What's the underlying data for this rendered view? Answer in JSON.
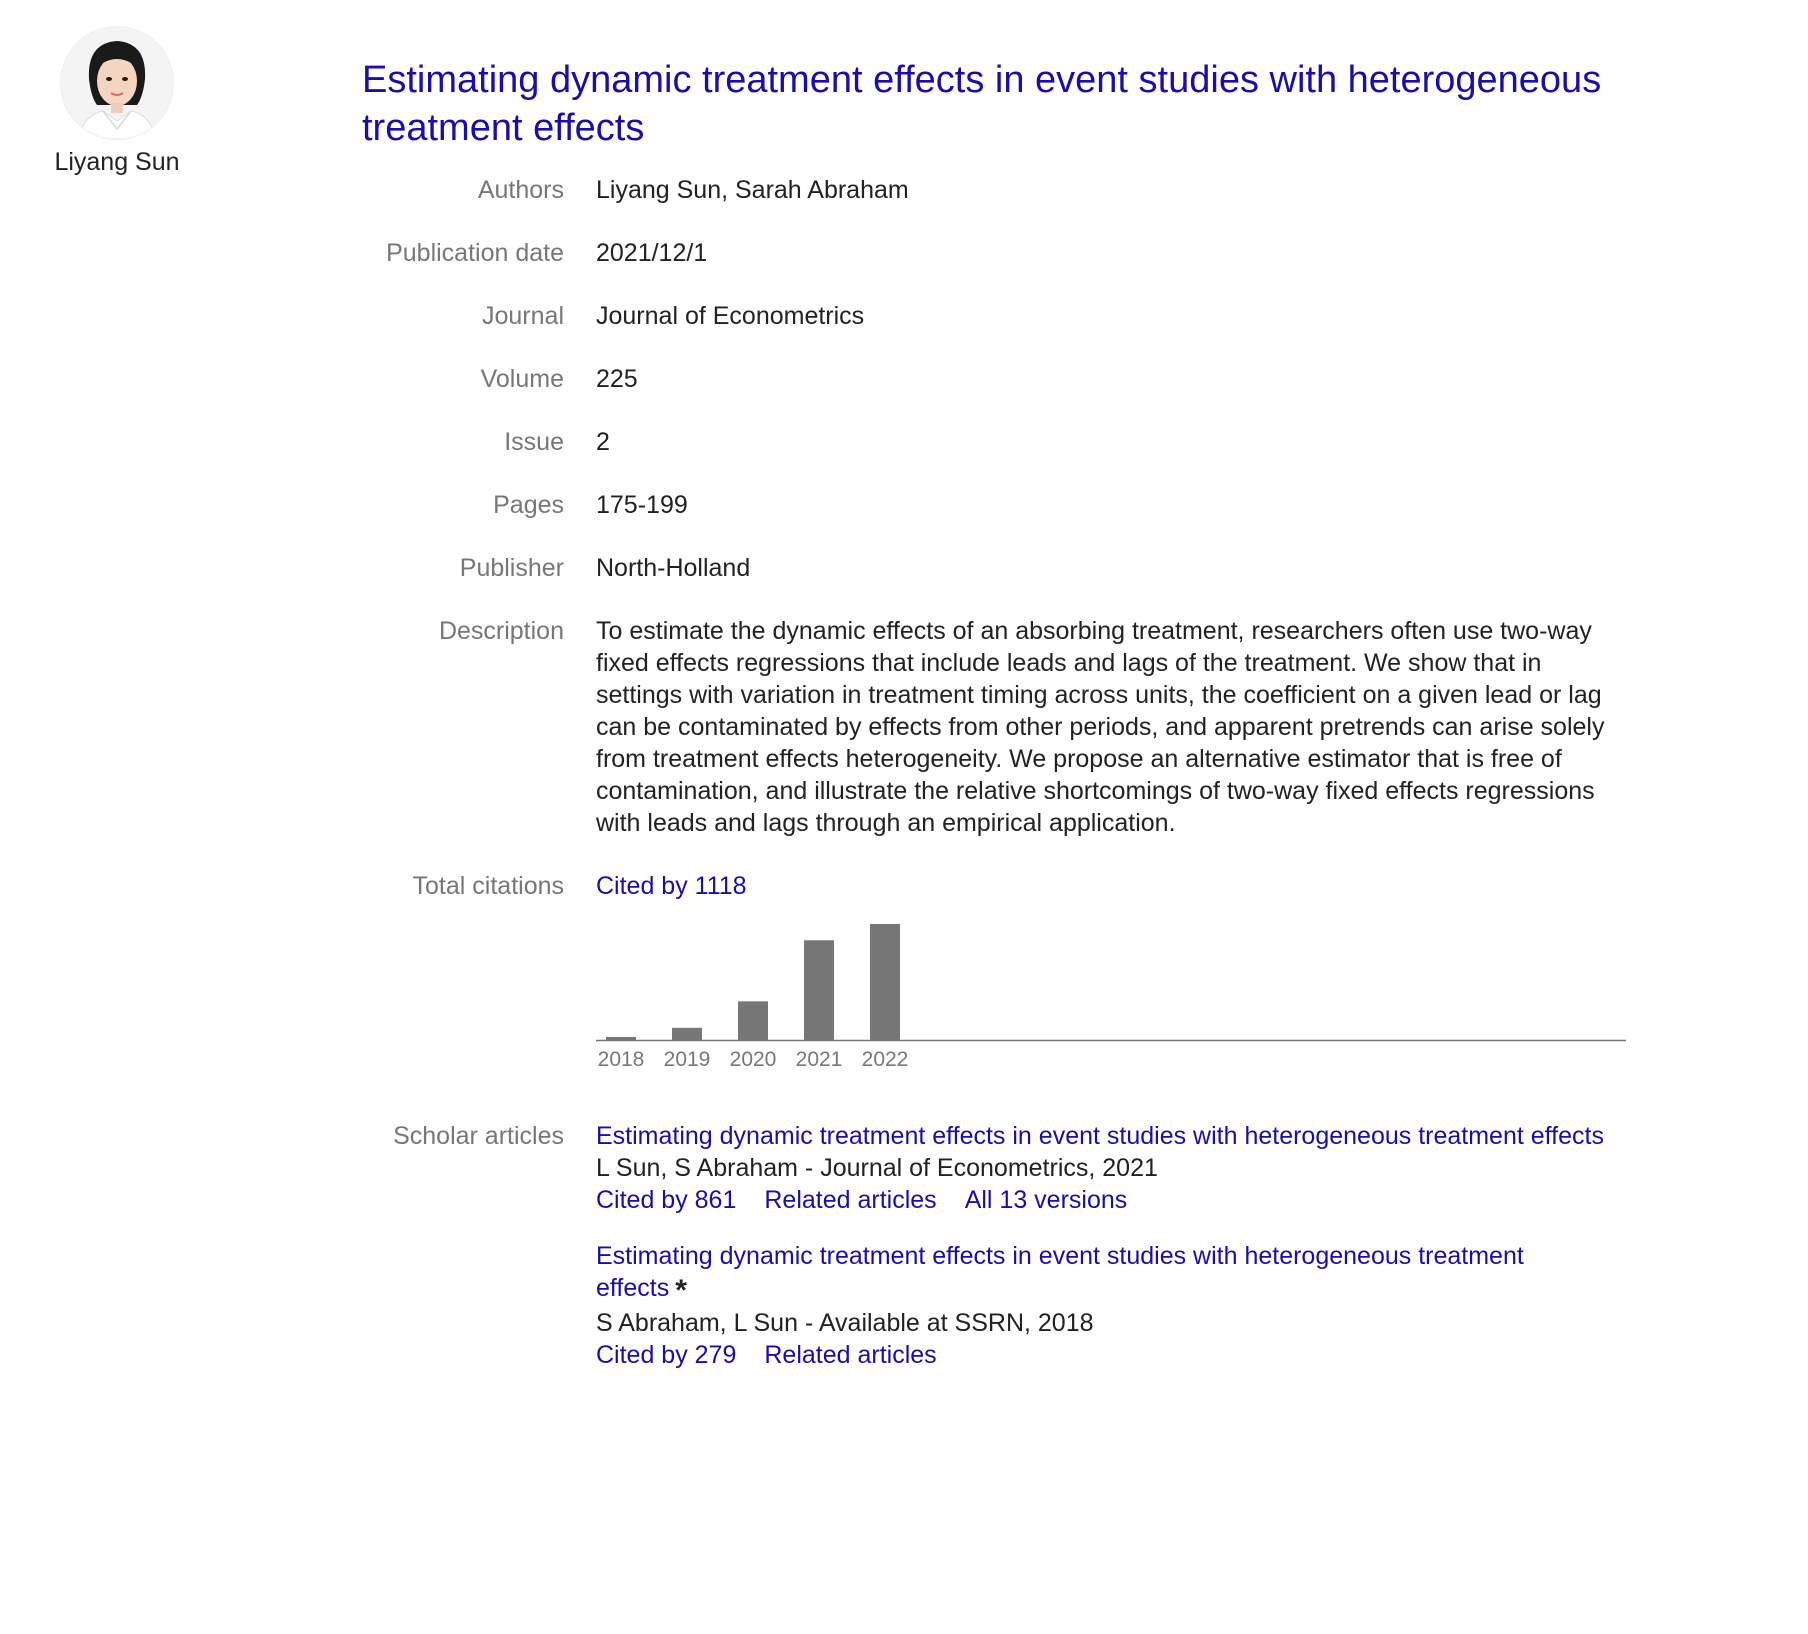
{
  "profile": {
    "name": "Liyang Sun"
  },
  "article": {
    "title": "Estimating dynamic treatment effects in event studies with heterogeneous treatment effects"
  },
  "fields": {
    "authors": {
      "label": "Authors",
      "value": "Liyang Sun, Sarah Abraham"
    },
    "publication_date": {
      "label": "Publication date",
      "value": "2021/12/1"
    },
    "journal": {
      "label": "Journal",
      "value": "Journal of Econometrics"
    },
    "volume": {
      "label": "Volume",
      "value": "225"
    },
    "issue": {
      "label": "Issue",
      "value": "2"
    },
    "pages": {
      "label": "Pages",
      "value": "175-199"
    },
    "publisher": {
      "label": "Publisher",
      "value": "North-Holland"
    },
    "description": {
      "label": "Description",
      "value": "To estimate the dynamic effects of an absorbing treatment, researchers often use two-way fixed effects regressions that include leads and lags of the treatment. We show that in settings with variation in treatment timing across units, the coefficient on a given lead or lag can be contaminated by effects from other periods, and apparent pretrends can arise solely from treatment effects heterogeneity. We propose an alternative estimator that is free of contamination, and illustrate the relative shortcomings of two-way fixed effects regressions with leads and lags through an empirical application."
    },
    "total_citations": {
      "label": "Total citations",
      "link": "Cited by 1118"
    },
    "scholar_articles": {
      "label": "Scholar articles"
    }
  },
  "chart_data": {
    "type": "bar",
    "categories": [
      "2018",
      "2019",
      "2020",
      "2021",
      "2022"
    ],
    "values": [
      3,
      12,
      38,
      98,
      114
    ],
    "title": "",
    "xlabel": "",
    "ylabel": "",
    "ylim": [
      0,
      114
    ],
    "grid": false,
    "bar_color": "#777777"
  },
  "scholar_articles": [
    {
      "title": "Estimating dynamic treatment effects in event studies with heterogeneous treatment effects",
      "star": false,
      "meta": "L Sun, S Abraham - Journal of Econometrics, 2021",
      "links": [
        "Cited by 861",
        "Related articles",
        "All 13 versions"
      ]
    },
    {
      "title": "Estimating dynamic treatment effects in event studies with heterogeneous treatment effects",
      "star": true,
      "star_glyph": "*",
      "meta": "S Abraham, L Sun - Available at SSRN, 2018",
      "links": [
        "Cited by 279",
        "Related articles"
      ]
    }
  ],
  "colors": {
    "link": "#1a0dab",
    "label": "#777777",
    "text": "#222222"
  }
}
